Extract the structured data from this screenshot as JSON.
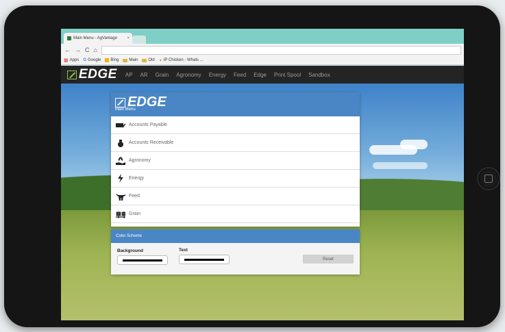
{
  "browser": {
    "tab_title": "Main Menu - AgVantage",
    "tab_close": "×",
    "bookmarks": [
      "Apps",
      "Google",
      "Bing",
      "Main",
      "Old",
      "IP Chicken - Whats ..."
    ]
  },
  "site_nav": {
    "logo": "EDGE",
    "items": [
      "AP",
      "AR",
      "Grain",
      "Agronomy",
      "Energy",
      "Feed",
      "Edge",
      "Print Spool",
      "Sandbox"
    ]
  },
  "panel": {
    "logo": "EDGE",
    "subtitle": "Main Menu",
    "items": [
      {
        "label": "Accounts Payable",
        "icon": "checkbook-icon"
      },
      {
        "label": "Accounts Receivable",
        "icon": "money-bag-icon"
      },
      {
        "label": "Agronomy",
        "icon": "plant-hand-icon"
      },
      {
        "label": "Energy",
        "icon": "lightning-icon"
      },
      {
        "label": "Feed",
        "icon": "cow-icon"
      },
      {
        "label": "Grain",
        "icon": "wheat-icon"
      }
    ]
  },
  "color_scheme": {
    "title": "Color Scheme",
    "background_label": "Background",
    "text_label": "Text",
    "background_color": "#000000",
    "text_color": "#000000",
    "reset_label": "Reset"
  }
}
